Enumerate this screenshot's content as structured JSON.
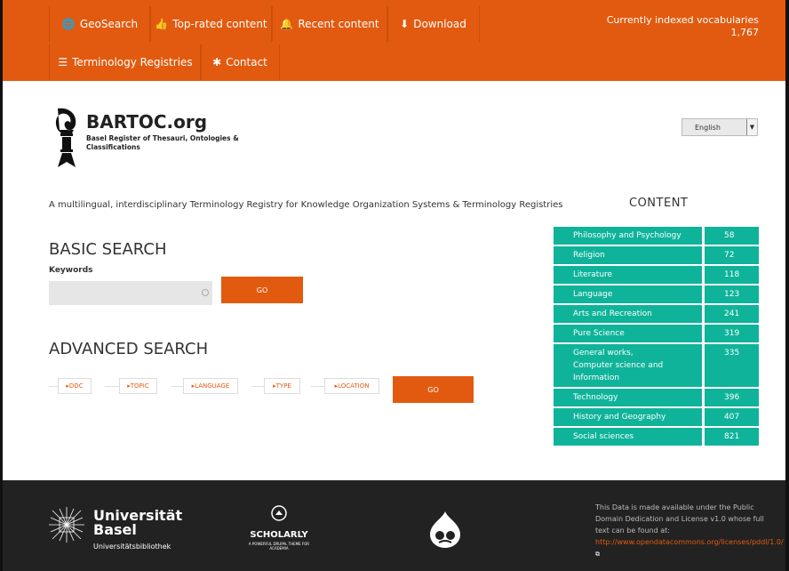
{
  "nav": {
    "items": [
      {
        "label": "GeoSearch",
        "icon": "globe-icon"
      },
      {
        "label": "Top-rated content",
        "icon": "thumbs-up-icon"
      },
      {
        "label": "Recent content",
        "icon": "bell-icon"
      },
      {
        "label": "Download",
        "icon": "download-icon"
      },
      {
        "label": "Terminology Registries",
        "icon": "list-icon"
      },
      {
        "label": "Contact",
        "icon": "asterisk-icon"
      }
    ],
    "count_label": "Currently indexed vocabularies",
    "count_value": "1,767"
  },
  "header": {
    "title": "BARTOC.org",
    "subtitle": "Basel Register of Thesauri, Ontologies & Classifications",
    "language": "English"
  },
  "tagline": "A multilingual, interdisciplinary Terminology Registry for Knowledge Organization Systems & Terminology Registries",
  "basic_search": {
    "heading": "BASIC SEARCH",
    "keywords_label": "Keywords",
    "go_label": "GO"
  },
  "advanced_search": {
    "heading": "ADVANCED SEARCH",
    "facets": [
      "DDC",
      "TOPIC",
      "LANGUAGE",
      "TYPE",
      "LOCATION"
    ],
    "go_label": "GO"
  },
  "content": {
    "heading": "CONTENT",
    "rows": [
      {
        "name": "Philosophy and Psychology",
        "count": "58"
      },
      {
        "name": "Religion",
        "count": "72"
      },
      {
        "name": "Literature",
        "count": "118"
      },
      {
        "name": "Language",
        "count": "123"
      },
      {
        "name": "Arts and Recreation",
        "count": "241"
      },
      {
        "name": "Pure Science",
        "count": "319"
      },
      {
        "name": "General works, Computer science and Information",
        "count": "335"
      },
      {
        "name": "Technology",
        "count": "396"
      },
      {
        "name": "History and Geography",
        "count": "407"
      },
      {
        "name": "Social sciences",
        "count": "821"
      }
    ]
  },
  "footer": {
    "university_name_1": "Universität",
    "university_name_2": "Basel",
    "university_sub": "Universitätsbibliothek",
    "scholarly_title": "SCHOLARLY",
    "scholarly_sub": "A POWERFUL DRUPAL THEME FOR ACADEMIA",
    "license_text": "This Data is made available under the Public Domain Dedication and License v1.0 whose full text can be found at:",
    "license_link": "http://www.opendatacommons.org/licenses/pddl/1.0/"
  },
  "colors": {
    "accent": "#e25a0f",
    "teal": "#0fb39a",
    "footer_bg": "#222222"
  }
}
